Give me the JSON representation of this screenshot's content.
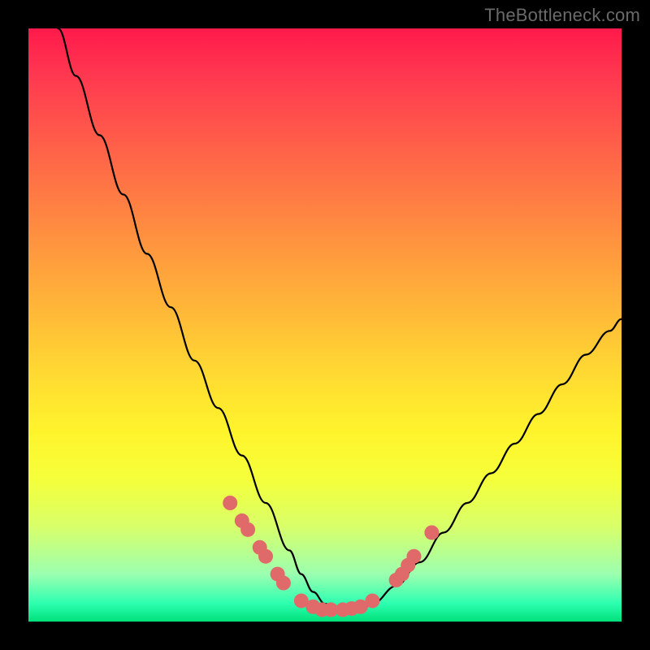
{
  "watermark": "TheBottleneck.com",
  "colors": {
    "curve": "#000000",
    "dots": "#e06a6a",
    "frame": "#000000"
  },
  "chart_data": {
    "type": "line",
    "title": "",
    "xlabel": "",
    "ylabel": "",
    "xlim": [
      0,
      100
    ],
    "ylim": [
      0,
      100
    ],
    "series": [
      {
        "name": "bottleneck-curve",
        "x": [
          5,
          8,
          12,
          16,
          20,
          24,
          28,
          32,
          36,
          40,
          44,
          46,
          48,
          50,
          52,
          54,
          56,
          58,
          62,
          66,
          70,
          74,
          78,
          82,
          86,
          90,
          94,
          98,
          100
        ],
        "y": [
          100,
          92,
          82,
          72,
          62,
          53,
          44,
          36,
          28,
          20,
          12,
          8,
          5,
          3,
          2,
          2,
          2,
          3,
          6,
          10,
          15,
          20,
          25,
          30,
          35,
          40,
          45,
          49,
          51
        ]
      }
    ],
    "scatter": [
      {
        "name": "marker-dots",
        "points": [
          {
            "x": 34,
            "y": 20
          },
          {
            "x": 36,
            "y": 17
          },
          {
            "x": 37,
            "y": 15.5
          },
          {
            "x": 39,
            "y": 12.5
          },
          {
            "x": 40,
            "y": 11
          },
          {
            "x": 42,
            "y": 8
          },
          {
            "x": 43,
            "y": 6.5
          },
          {
            "x": 46,
            "y": 3.5
          },
          {
            "x": 48,
            "y": 2.5
          },
          {
            "x": 49.5,
            "y": 2
          },
          {
            "x": 51,
            "y": 2
          },
          {
            "x": 53,
            "y": 2
          },
          {
            "x": 54.5,
            "y": 2.2
          },
          {
            "x": 56,
            "y": 2.5
          },
          {
            "x": 58,
            "y": 3.5
          },
          {
            "x": 62,
            "y": 7
          },
          {
            "x": 63,
            "y": 8
          },
          {
            "x": 64,
            "y": 9.5
          },
          {
            "x": 65,
            "y": 11
          },
          {
            "x": 68,
            "y": 15
          }
        ]
      }
    ]
  }
}
